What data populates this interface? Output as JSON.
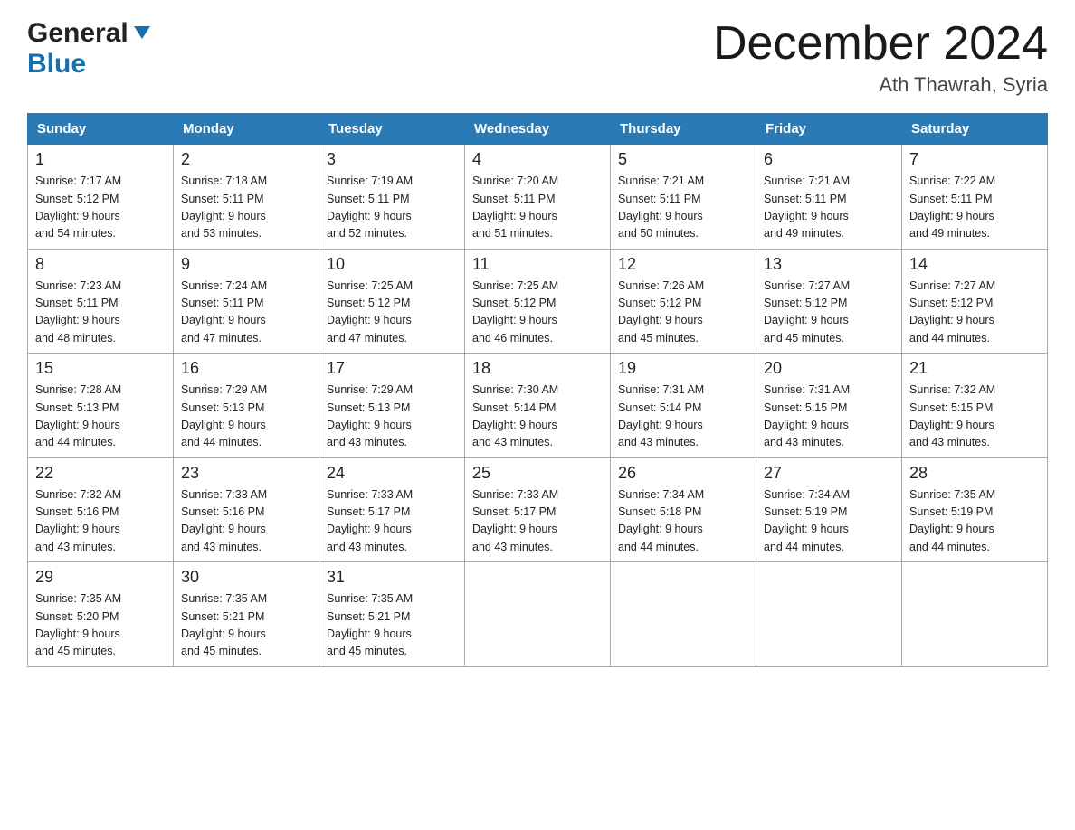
{
  "header": {
    "logo_general": "General",
    "logo_blue": "Blue",
    "month_title": "December 2024",
    "location": "Ath Thawrah, Syria"
  },
  "days_of_week": [
    "Sunday",
    "Monday",
    "Tuesday",
    "Wednesday",
    "Thursday",
    "Friday",
    "Saturday"
  ],
  "weeks": [
    [
      {
        "day": "1",
        "sunrise": "7:17 AM",
        "sunset": "5:12 PM",
        "daylight": "9 hours and 54 minutes."
      },
      {
        "day": "2",
        "sunrise": "7:18 AM",
        "sunset": "5:11 PM",
        "daylight": "9 hours and 53 minutes."
      },
      {
        "day": "3",
        "sunrise": "7:19 AM",
        "sunset": "5:11 PM",
        "daylight": "9 hours and 52 minutes."
      },
      {
        "day": "4",
        "sunrise": "7:20 AM",
        "sunset": "5:11 PM",
        "daylight": "9 hours and 51 minutes."
      },
      {
        "day": "5",
        "sunrise": "7:21 AM",
        "sunset": "5:11 PM",
        "daylight": "9 hours and 50 minutes."
      },
      {
        "day": "6",
        "sunrise": "7:21 AM",
        "sunset": "5:11 PM",
        "daylight": "9 hours and 49 minutes."
      },
      {
        "day": "7",
        "sunrise": "7:22 AM",
        "sunset": "5:11 PM",
        "daylight": "9 hours and 49 minutes."
      }
    ],
    [
      {
        "day": "8",
        "sunrise": "7:23 AM",
        "sunset": "5:11 PM",
        "daylight": "9 hours and 48 minutes."
      },
      {
        "day": "9",
        "sunrise": "7:24 AM",
        "sunset": "5:11 PM",
        "daylight": "9 hours and 47 minutes."
      },
      {
        "day": "10",
        "sunrise": "7:25 AM",
        "sunset": "5:12 PM",
        "daylight": "9 hours and 47 minutes."
      },
      {
        "day": "11",
        "sunrise": "7:25 AM",
        "sunset": "5:12 PM",
        "daylight": "9 hours and 46 minutes."
      },
      {
        "day": "12",
        "sunrise": "7:26 AM",
        "sunset": "5:12 PM",
        "daylight": "9 hours and 45 minutes."
      },
      {
        "day": "13",
        "sunrise": "7:27 AM",
        "sunset": "5:12 PM",
        "daylight": "9 hours and 45 minutes."
      },
      {
        "day": "14",
        "sunrise": "7:27 AM",
        "sunset": "5:12 PM",
        "daylight": "9 hours and 44 minutes."
      }
    ],
    [
      {
        "day": "15",
        "sunrise": "7:28 AM",
        "sunset": "5:13 PM",
        "daylight": "9 hours and 44 minutes."
      },
      {
        "day": "16",
        "sunrise": "7:29 AM",
        "sunset": "5:13 PM",
        "daylight": "9 hours and 44 minutes."
      },
      {
        "day": "17",
        "sunrise": "7:29 AM",
        "sunset": "5:13 PM",
        "daylight": "9 hours and 43 minutes."
      },
      {
        "day": "18",
        "sunrise": "7:30 AM",
        "sunset": "5:14 PM",
        "daylight": "9 hours and 43 minutes."
      },
      {
        "day": "19",
        "sunrise": "7:31 AM",
        "sunset": "5:14 PM",
        "daylight": "9 hours and 43 minutes."
      },
      {
        "day": "20",
        "sunrise": "7:31 AM",
        "sunset": "5:15 PM",
        "daylight": "9 hours and 43 minutes."
      },
      {
        "day": "21",
        "sunrise": "7:32 AM",
        "sunset": "5:15 PM",
        "daylight": "9 hours and 43 minutes."
      }
    ],
    [
      {
        "day": "22",
        "sunrise": "7:32 AM",
        "sunset": "5:16 PM",
        "daylight": "9 hours and 43 minutes."
      },
      {
        "day": "23",
        "sunrise": "7:33 AM",
        "sunset": "5:16 PM",
        "daylight": "9 hours and 43 minutes."
      },
      {
        "day": "24",
        "sunrise": "7:33 AM",
        "sunset": "5:17 PM",
        "daylight": "9 hours and 43 minutes."
      },
      {
        "day": "25",
        "sunrise": "7:33 AM",
        "sunset": "5:17 PM",
        "daylight": "9 hours and 43 minutes."
      },
      {
        "day": "26",
        "sunrise": "7:34 AM",
        "sunset": "5:18 PM",
        "daylight": "9 hours and 44 minutes."
      },
      {
        "day": "27",
        "sunrise": "7:34 AM",
        "sunset": "5:19 PM",
        "daylight": "9 hours and 44 minutes."
      },
      {
        "day": "28",
        "sunrise": "7:35 AM",
        "sunset": "5:19 PM",
        "daylight": "9 hours and 44 minutes."
      }
    ],
    [
      {
        "day": "29",
        "sunrise": "7:35 AM",
        "sunset": "5:20 PM",
        "daylight": "9 hours and 45 minutes."
      },
      {
        "day": "30",
        "sunrise": "7:35 AM",
        "sunset": "5:21 PM",
        "daylight": "9 hours and 45 minutes."
      },
      {
        "day": "31",
        "sunrise": "7:35 AM",
        "sunset": "5:21 PM",
        "daylight": "9 hours and 45 minutes."
      },
      null,
      null,
      null,
      null
    ]
  ],
  "labels": {
    "sunrise": "Sunrise:",
    "sunset": "Sunset:",
    "daylight": "Daylight:"
  }
}
